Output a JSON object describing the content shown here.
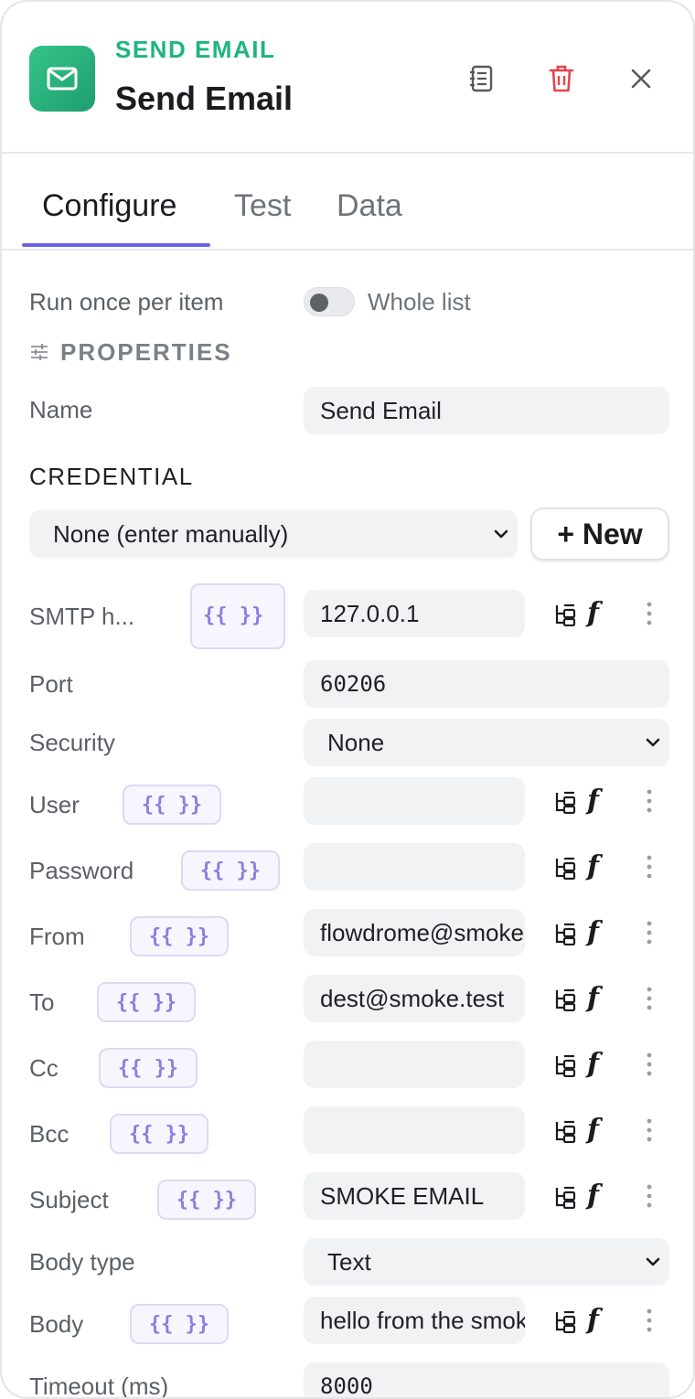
{
  "header": {
    "kind": "SEND EMAIL",
    "title": "Send Email"
  },
  "tabs": [
    {
      "label": "Configure",
      "active": true
    },
    {
      "label": "Test",
      "active": false
    },
    {
      "label": "Data",
      "active": false
    }
  ],
  "run_mode": {
    "left_label": "Run once per item",
    "right_label": "Whole list",
    "whole_list_on": false
  },
  "properties_title": "PROPERTIES",
  "name_field": {
    "label": "Name",
    "value": "Send Email"
  },
  "credential": {
    "title": "CREDENTIAL",
    "selected": "None (enter manually)",
    "new_button": "+ New"
  },
  "expr_label": "{{ }}",
  "fields": {
    "smtp_host": {
      "label": "SMTP h...",
      "value": "127.0.0.1"
    },
    "port": {
      "label": "Port",
      "value": "60206"
    },
    "security": {
      "label": "Security",
      "value": "None"
    },
    "user": {
      "label": "User",
      "value": ""
    },
    "password": {
      "label": "Password",
      "value": ""
    },
    "from": {
      "label": "From",
      "value": "flowdrome@smoke.test"
    },
    "to": {
      "label": "To",
      "value": "dest@smoke.test"
    },
    "cc": {
      "label": "Cc",
      "value": ""
    },
    "bcc": {
      "label": "Bcc",
      "value": ""
    },
    "subject": {
      "label": "Subject",
      "value": "SMOKE EMAIL"
    },
    "body_type": {
      "label": "Body type",
      "value": "Text"
    },
    "body": {
      "label": "Body",
      "value": "hello from the smoke test"
    },
    "timeout": {
      "label": "Timeout (ms)",
      "value": "8000"
    }
  },
  "colors": {
    "accent": "#6c63e0",
    "brand_green": "#1eb57f",
    "delete_red": "#e0464e"
  },
  "icons": [
    "envelope-icon",
    "notes-icon",
    "trash-icon",
    "close-icon",
    "sliders-icon",
    "chevron-down-icon",
    "tree-icon",
    "function-icon",
    "more-vertical-icon"
  ]
}
